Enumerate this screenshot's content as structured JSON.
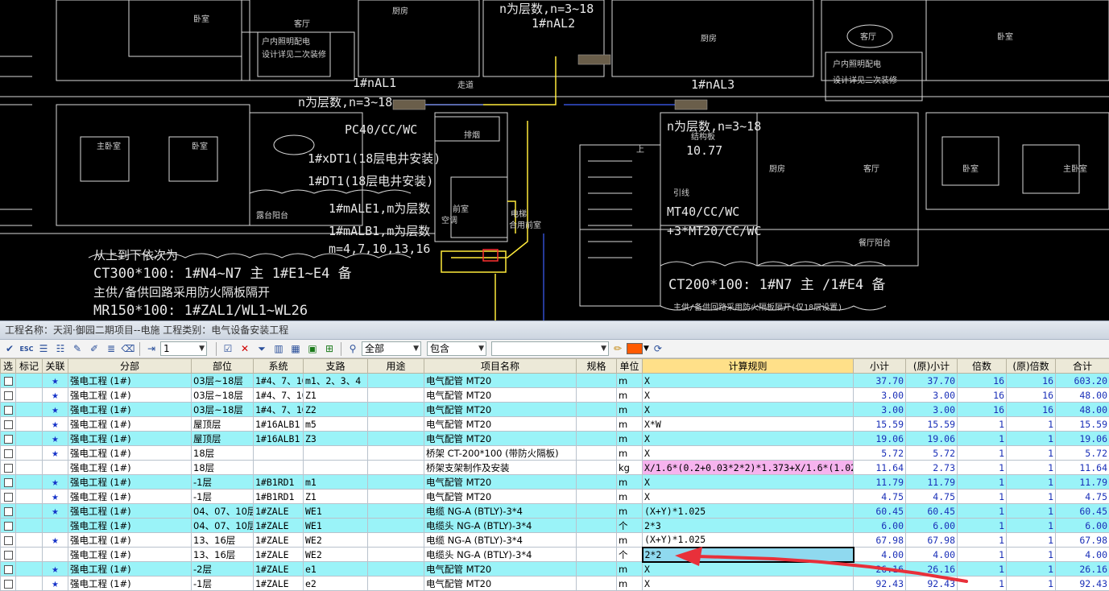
{
  "drawing": {
    "labels": [
      "卧室",
      "客厅",
      "厨房",
      "n为层数,n=3~18",
      "1#nAL2",
      "户内照明配电",
      "设计详见二次装修",
      "1#nAL1",
      "n为层数,n=3~18",
      "走道",
      "PC40/CC/WC",
      "1#xDT1(18层电井安装)",
      "1#DT1(18层电井安装)",
      "1#mALE1,m为层数",
      "1#mALB1,m为层数",
      "m=4,7,10,13,16",
      "主卧室",
      "卧室",
      "露台阳台",
      "从上到下依次为",
      "CT300*100: 1#N4~N7 主 1#E1~E4 备",
      "主供/备供回路采用防火隔板隔开",
      "MR150*100: 1#ZAL1/WL1~WL26",
      "1#nAL3",
      "n为层数,n=3~18",
      "结构板",
      "10.77",
      "引线",
      "MT40/CC/WC",
      "+3*MT20/CC/WC",
      "CT200*100: 1#N7 主 /1#E4 备",
      "主供/备供回路采用防火隔板隔开(仅18层设置)",
      "客厅",
      "厨房",
      "卧室",
      "户内照明配电",
      "设计详见二次装修",
      "主卧室",
      "客厅",
      "卧室",
      "厨房",
      "餐厅阳台",
      "排烟",
      "前室",
      "合用前室",
      "电梯",
      "空调",
      "上"
    ]
  },
  "project_info": "工程名称：天润·御园二期项目--电施  工程类别：电气设备安装工程",
  "toolbar": {
    "level_value": "1",
    "filter_all": "全部",
    "filter_contains": "包含",
    "search_value": "",
    "color_swatch": "#ff5a00",
    "icons": [
      "check-icon",
      "esc-icon",
      "list-icon",
      "list-check-icon",
      "edit-icon",
      "paint-icon",
      "clear-icon",
      "eraser-icon",
      "indent-icon",
      "select-icon",
      "delete-icon",
      "filter-icon",
      "chart-icon",
      "calc-icon",
      "excel-icon",
      "export-icon",
      "binoculars-icon",
      "pencil-icon",
      "refresh-icon"
    ]
  },
  "table": {
    "headers": [
      "选",
      "标记",
      "关联",
      "分部",
      "部位",
      "系统",
      "支路",
      "用途",
      "项目名称",
      "规格",
      "单位",
      "计算规则",
      "小计",
      "(原)小计",
      "倍数",
      "(原)倍数",
      "合计"
    ],
    "rows": [
      {
        "style": "cyan",
        "star": true,
        "fenbu": "强电工程 (1#)",
        "buwei": "03层~18层",
        "xitong": "1#4、7、10",
        "zhilu": "m1、2、3、4",
        "yongtu": "",
        "name": "电气配管 MT20",
        "guige": "",
        "unit": "m",
        "rule": "X",
        "xiaoji": "37.70",
        "yxiaoji": "37.70",
        "beishu": "16",
        "ybeishu": "16",
        "heji": "603.20"
      },
      {
        "style": "white",
        "star": true,
        "fenbu": "强电工程 (1#)",
        "buwei": "03层~18层",
        "xitong": "1#4、7、10",
        "zhilu": "Z1",
        "yongtu": "",
        "name": "电气配管 MT20",
        "guige": "",
        "unit": "m",
        "rule": "X",
        "xiaoji": "3.00",
        "yxiaoji": "3.00",
        "beishu": "16",
        "ybeishu": "16",
        "heji": "48.00"
      },
      {
        "style": "cyan",
        "star": true,
        "fenbu": "强电工程 (1#)",
        "buwei": "03层~18层",
        "xitong": "1#4、7、10",
        "zhilu": "Z2",
        "yongtu": "",
        "name": "电气配管 MT20",
        "guige": "",
        "unit": "m",
        "rule": "X",
        "xiaoji": "3.00",
        "yxiaoji": "3.00",
        "beishu": "16",
        "ybeishu": "16",
        "heji": "48.00"
      },
      {
        "style": "white",
        "star": true,
        "fenbu": "强电工程 (1#)",
        "buwei": "屋顶层",
        "xitong": "1#16ALB1",
        "zhilu": "m5",
        "yongtu": "",
        "name": "电气配管 MT20",
        "guige": "",
        "unit": "m",
        "rule": "X*W",
        "xiaoji": "15.59",
        "yxiaoji": "15.59",
        "beishu": "1",
        "ybeishu": "1",
        "heji": "15.59"
      },
      {
        "style": "cyan",
        "star": true,
        "fenbu": "强电工程 (1#)",
        "buwei": "屋顶层",
        "xitong": "1#16ALB1",
        "zhilu": "Z3",
        "yongtu": "",
        "name": "电气配管 MT20",
        "guige": "",
        "unit": "m",
        "rule": "X",
        "xiaoji": "19.06",
        "yxiaoji": "19.06",
        "beishu": "1",
        "ybeishu": "1",
        "heji": "19.06"
      },
      {
        "style": "white",
        "star": true,
        "fenbu": "强电工程 (1#)",
        "buwei": "18层",
        "xitong": "",
        "zhilu": "",
        "yongtu": "",
        "name": "桥架 CT-200*100 (带防火隔板)",
        "guige": "",
        "unit": "m",
        "rule": "X",
        "xiaoji": "5.72",
        "yxiaoji": "5.72",
        "beishu": "1",
        "ybeishu": "1",
        "heji": "5.72"
      },
      {
        "style": "white",
        "star": false,
        "fenbu": "强电工程 (1#)",
        "buwei": "18层",
        "xitong": "",
        "zhilu": "",
        "yongtu": "",
        "name": "桥架支架制作及安装",
        "guige": "",
        "unit": "kg",
        "rule": "X/1.6*(0.2+0.03*2*2)*1.373+X/1.6*(1.025*2)*",
        "rulePink": true,
        "xiaoji": "11.64",
        "yxiaoji": "2.73",
        "beishu": "1",
        "ybeishu": "1",
        "heji": "11.64"
      },
      {
        "style": "cyan",
        "star": true,
        "fenbu": "强电工程 (1#)",
        "buwei": "-1层",
        "xitong": "1#B1RD1",
        "zhilu": "m1",
        "yongtu": "",
        "name": "电气配管 MT20",
        "guige": "",
        "unit": "m",
        "rule": "X",
        "xiaoji": "11.79",
        "yxiaoji": "11.79",
        "beishu": "1",
        "ybeishu": "1",
        "heji": "11.79"
      },
      {
        "style": "white",
        "star": true,
        "fenbu": "强电工程 (1#)",
        "buwei": "-1层",
        "xitong": "1#B1RD1",
        "zhilu": "Z1",
        "yongtu": "",
        "name": "电气配管 MT20",
        "guige": "",
        "unit": "m",
        "rule": "X",
        "xiaoji": "4.75",
        "yxiaoji": "4.75",
        "beishu": "1",
        "ybeishu": "1",
        "heji": "4.75"
      },
      {
        "style": "cyan",
        "star": true,
        "fenbu": "强电工程 (1#)",
        "buwei": "04、07、10层",
        "xitong": "1#ZALE",
        "zhilu": "WE1",
        "yongtu": "",
        "name": "电缆 NG-A (BTLY)-3*4",
        "guige": "",
        "unit": "m",
        "rule": "(X+Y)*1.025",
        "xiaoji": "60.45",
        "yxiaoji": "60.45",
        "beishu": "1",
        "ybeishu": "1",
        "heji": "60.45"
      },
      {
        "style": "cyan",
        "star": false,
        "fenbu": "强电工程 (1#)",
        "buwei": "04、07、10层",
        "xitong": "1#ZALE",
        "zhilu": "WE1",
        "yongtu": "",
        "name": "电缆头 NG-A (BTLY)-3*4",
        "guige": "",
        "unit": "个",
        "rule": "2*3",
        "xiaoji": "6.00",
        "yxiaoji": "6.00",
        "beishu": "1",
        "ybeishu": "1",
        "heji": "6.00"
      },
      {
        "style": "white",
        "star": true,
        "fenbu": "强电工程 (1#)",
        "buwei": "13、16层",
        "xitong": "1#ZALE",
        "zhilu": "WE2",
        "yongtu": "",
        "name": "电缆 NG-A (BTLY)-3*4",
        "guige": "",
        "unit": "m",
        "rule": "(X+Y)*1.025",
        "xiaoji": "67.98",
        "yxiaoji": "67.98",
        "beishu": "1",
        "ybeishu": "1",
        "heji": "67.98"
      },
      {
        "style": "white",
        "star": false,
        "fenbu": "强电工程 (1#)",
        "buwei": "13、16层",
        "xitong": "1#ZALE",
        "zhilu": "WE2",
        "yongtu": "",
        "name": "电缆头 NG-A (BTLY)-3*4",
        "guige": "",
        "unit": "个",
        "rule": "2*2",
        "ruleSel": true,
        "xiaoji": "4.00",
        "yxiaoji": "4.00",
        "beishu": "1",
        "ybeishu": "1",
        "heji": "4.00"
      },
      {
        "style": "cyan",
        "star": true,
        "fenbu": "强电工程 (1#)",
        "buwei": "-2层",
        "xitong": "1#ZALE",
        "zhilu": "e1",
        "yongtu": "",
        "name": "电气配管 MT20",
        "guige": "",
        "unit": "m",
        "rule": "X",
        "xiaoji": "26.16",
        "yxiaoji": "26.16",
        "beishu": "1",
        "ybeishu": "1",
        "heji": "26.16"
      },
      {
        "style": "white",
        "star": true,
        "fenbu": "强电工程 (1#)",
        "buwei": "-1层",
        "xitong": "1#ZALE",
        "zhilu": "e2",
        "yongtu": "",
        "name": "电气配管 MT20",
        "guige": "",
        "unit": "m",
        "rule": "X",
        "xiaoji": "92.43",
        "yxiaoji": "92.43",
        "beishu": "1",
        "ybeishu": "1",
        "heji": "92.43"
      }
    ]
  }
}
